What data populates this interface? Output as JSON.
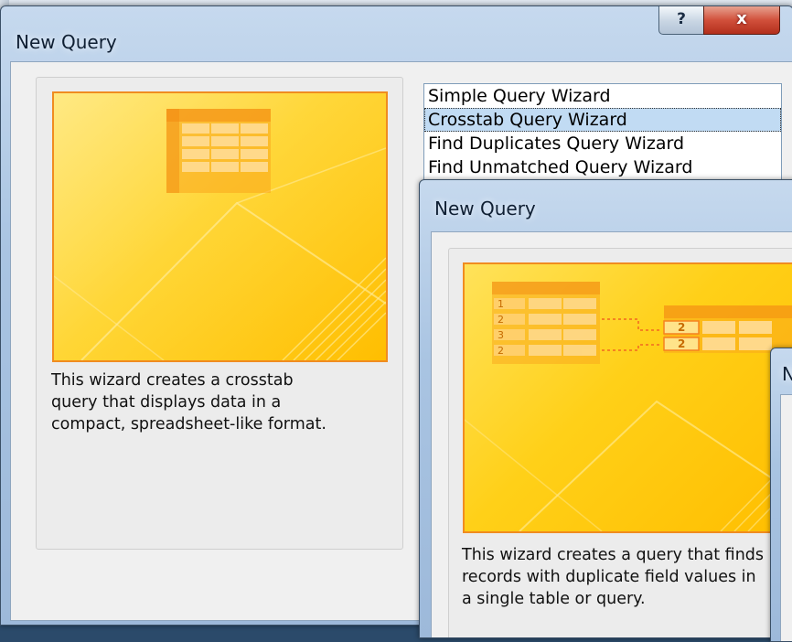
{
  "dialog1": {
    "title": "New Query",
    "help_glyph": "?",
    "close_glyph": "x",
    "wizards": [
      {
        "label": "Simple Query Wizard",
        "selected": false
      },
      {
        "label": "Crosstab Query Wizard",
        "selected": true
      },
      {
        "label": "Find Duplicates Query Wizard",
        "selected": false
      },
      {
        "label": "Find Unmatched Query Wizard",
        "selected": false
      }
    ],
    "description": "This wizard creates a crosstab query that displays data in a compact, spreadsheet-like format."
  },
  "dialog2": {
    "title": "New Query",
    "left_table_numbers": [
      "1",
      "2",
      "3",
      "2"
    ],
    "right_table_numbers": [
      "2",
      "2"
    ],
    "description": "This wizard creates a query that finds records with duplicate field values in a single table or query."
  },
  "dialog3": {
    "title_partial": "N"
  },
  "colors": {
    "preview_yellow": "#ffd018",
    "preview_border": "#f08c20",
    "selection": "#c1dbf3",
    "close_red": "#d1503b"
  }
}
